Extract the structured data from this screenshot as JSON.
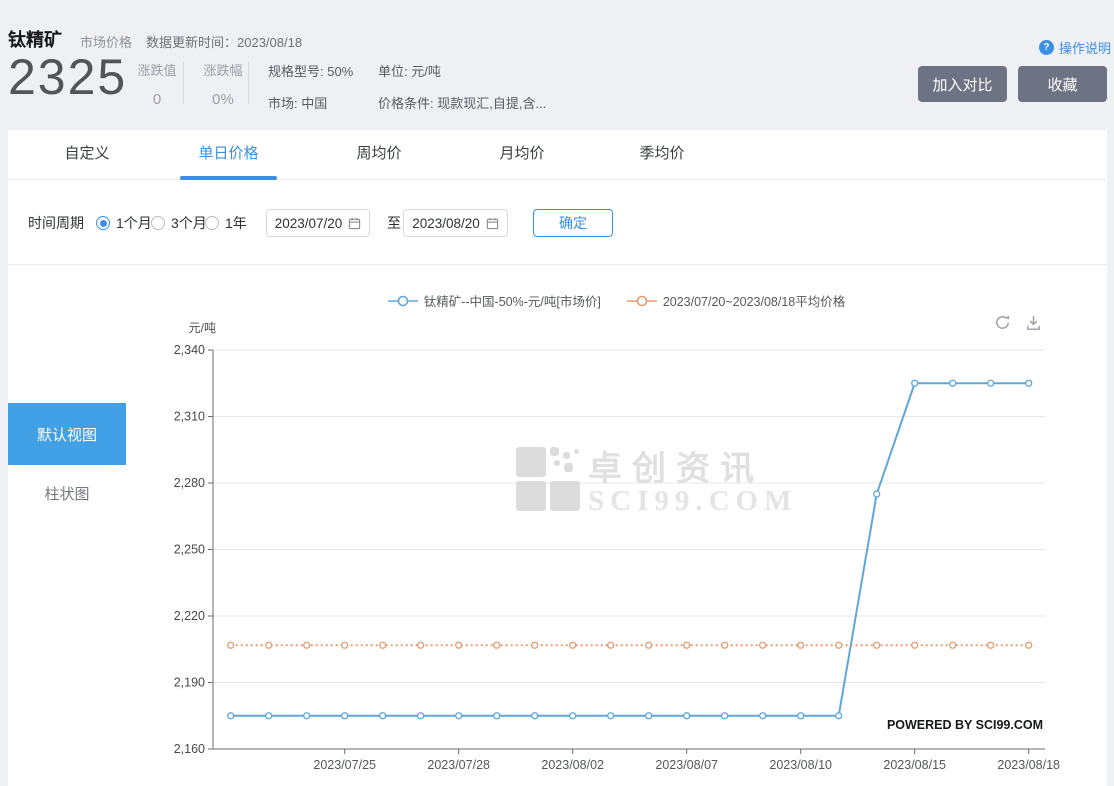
{
  "colors": {
    "bg": "#eef0f4",
    "accent": "#3b8fe2",
    "sidebar_active": "#42a0e6",
    "button": "#6d7382",
    "line_blue": "#5ea7d8",
    "line_orange": "#e89b6e"
  },
  "header": {
    "title": "钛精矿",
    "subtitle": "市场价格",
    "update_label": "数据更新时间：",
    "update_date": "2023/08/18",
    "help_label": "操作说明",
    "help_icon": "?",
    "price": "2325",
    "change_value_label": "涨跌值",
    "change_value": "0",
    "change_pct_label": "涨跌幅",
    "change_pct": "0%",
    "spec": "规格型号: 50%",
    "market": "市场: 中国",
    "unit": "单位: 元/吨",
    "condition": "价格条件: 现款现汇,自提,含...",
    "compare_button": "加入对比",
    "favorite_button": "收藏"
  },
  "tabs": {
    "items": [
      {
        "label": "自定义"
      },
      {
        "label": "单日价格"
      },
      {
        "label": "周均价"
      },
      {
        "label": "月均价"
      },
      {
        "label": "季均价"
      }
    ],
    "active": "单日价格"
  },
  "filter": {
    "period_label": "时间周期",
    "options": [
      {
        "label": "1个月",
        "selected": true
      },
      {
        "label": "3个月",
        "selected": false
      },
      {
        "label": "1年",
        "selected": false
      }
    ],
    "start_date": "2023/07/20",
    "to_label": "至",
    "end_date": "2023/08/20",
    "confirm_label": "确定"
  },
  "sidebar": {
    "default_view": "默认视图",
    "bar_view": "柱状图"
  },
  "chart": {
    "unit_label": "元/吨",
    "watermark_cn": "卓创资讯",
    "watermark_en": "SCI99.COM",
    "powered_by": "POWERED BY SCI99.COM"
  },
  "chart_data": {
    "type": "line",
    "ylabel": "元/吨",
    "ylim": [
      2160,
      2340
    ],
    "y_ticks": [
      2160,
      2190,
      2220,
      2250,
      2280,
      2310,
      2340
    ],
    "grid": true,
    "legend_position": "top",
    "x": [
      "2023/07/20",
      "2023/07/21",
      "2023/07/24",
      "2023/07/25",
      "2023/07/26",
      "2023/07/27",
      "2023/07/28",
      "2023/07/31",
      "2023/08/01",
      "2023/08/02",
      "2023/08/03",
      "2023/08/04",
      "2023/08/07",
      "2023/08/08",
      "2023/08/09",
      "2023/08/10",
      "2023/08/11",
      "2023/08/14",
      "2023/08/15",
      "2023/08/16",
      "2023/08/17",
      "2023/08/18"
    ],
    "x_tick_labels": [
      "2023/07/25",
      "2023/07/28",
      "2023/08/02",
      "2023/08/07",
      "2023/08/10",
      "2023/08/15",
      "2023/08/18"
    ],
    "series": [
      {
        "name": "钛精矿--中国-50%-元/吨[市场价]",
        "color": "#5ea7d8",
        "style": "solid",
        "values": [
          2175,
          2175,
          2175,
          2175,
          2175,
          2175,
          2175,
          2175,
          2175,
          2175,
          2175,
          2175,
          2175,
          2175,
          2175,
          2175,
          2175,
          2275,
          2325,
          2325,
          2325,
          2325
        ]
      },
      {
        "name": "2023/07/20~2023/08/18平均价格",
        "color": "#e89b6e",
        "style": "dotted",
        "values": [
          2206.8,
          2206.8,
          2206.8,
          2206.8,
          2206.8,
          2206.8,
          2206.8,
          2206.8,
          2206.8,
          2206.8,
          2206.8,
          2206.8,
          2206.8,
          2206.8,
          2206.8,
          2206.8,
          2206.8,
          2206.8,
          2206.8,
          2206.8,
          2206.8,
          2206.8
        ]
      }
    ]
  }
}
